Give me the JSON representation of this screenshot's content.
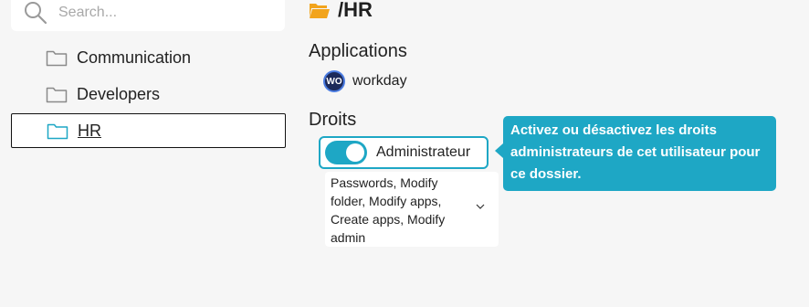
{
  "search": {
    "placeholder": "Search..."
  },
  "sidebar": {
    "items": [
      {
        "label": "Communication"
      },
      {
        "label": "Developers"
      },
      {
        "label": "HR"
      }
    ]
  },
  "main": {
    "title": "/HR",
    "applications_heading": "Applications",
    "app": {
      "badge": "WO",
      "name": "workday"
    },
    "rights_heading": "Droits",
    "admin_toggle": {
      "label": "Administrateur",
      "state": "on"
    },
    "permissions": "Passwords, Modify folder, Modify apps, Create apps, Modify admin"
  },
  "tooltip": {
    "text": "Activez ou désactivez les droits administrateurs de cet utilisateur pour ce dossier."
  },
  "colors": {
    "accent": "#1ea7c5",
    "folder_open": "#f2a41c"
  }
}
